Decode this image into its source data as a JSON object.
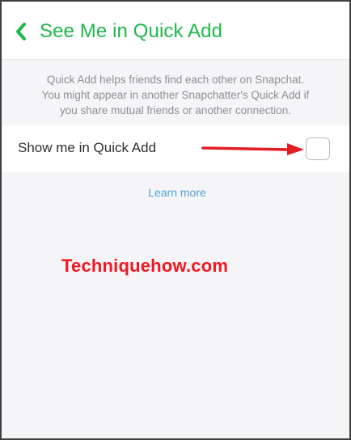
{
  "header": {
    "back_icon": "chevron-left-icon",
    "title": "See Me in Quick Add"
  },
  "description": {
    "lines": [
      "Quick Add helps friends find each other on Snapchat.",
      "You might appear in another Snapchatter's Quick Add if",
      "you share mutual friends or another connection."
    ]
  },
  "setting": {
    "label": "Show me in Quick Add",
    "checked": false
  },
  "annotation": {
    "arrow_icon": "arrow-right-icon",
    "arrow_color": "#e31d24"
  },
  "learn_more": {
    "label": "Learn more"
  },
  "watermark": {
    "text": "Techniquehow.com"
  },
  "colors": {
    "accent": "#1fb84a",
    "link": "#4ea3d8",
    "watermark": "#f01822"
  }
}
